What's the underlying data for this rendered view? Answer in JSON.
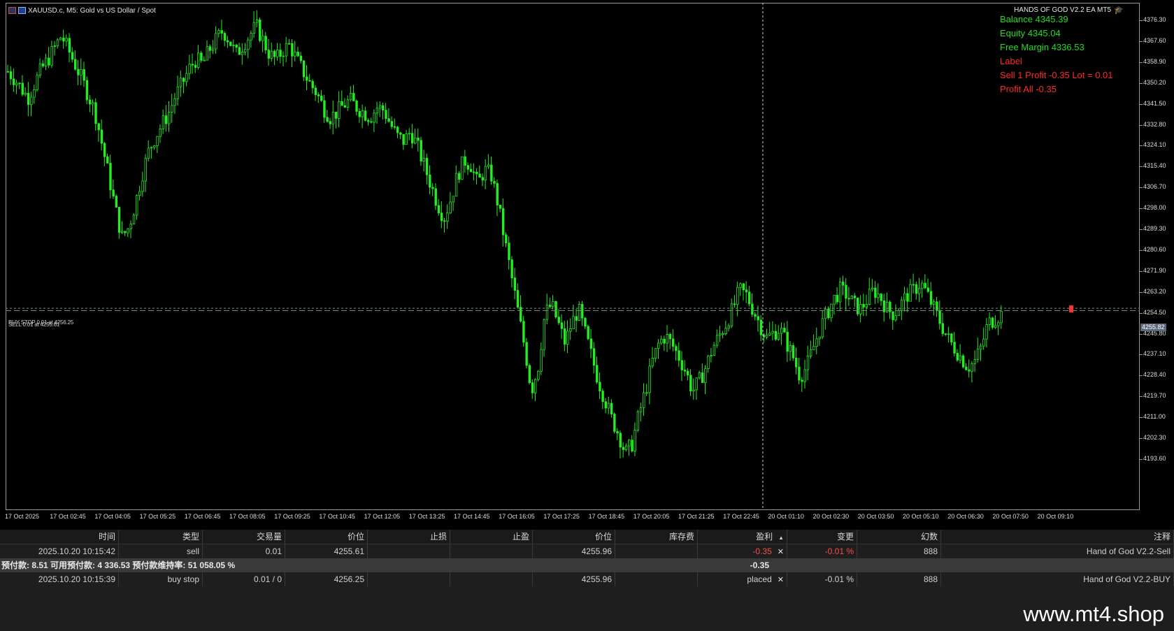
{
  "chart": {
    "symbol_line": "XAUUSD.c, M5:  Gold vs US Dollar / Spot",
    "ea_name": "HANDS OF GOD V2.2 EA MT5",
    "info": [
      {
        "text": "Balance 4345.39",
        "color": "#22dd22"
      },
      {
        "text": "Equity 4345.04",
        "color": "#22dd22"
      },
      {
        "text": "Free Margin 4336.53",
        "color": "#22dd22"
      },
      {
        "text": "Label",
        "color": "#ff2a2a"
      },
      {
        "text": "Sell 1   Profit -0.35  Lot = 0.01",
        "color": "#ff2a2a"
      },
      {
        "text": "Profit All -0.35",
        "color": "#ff2a2a"
      }
    ],
    "order_line_label": "BUY STOP 0.01 at 4256.25",
    "order_line_label2": "SELL 0.01 at 4255.61",
    "current_price": "4255.82",
    "price_ticks": [
      "4376.30",
      "4367.60",
      "4358.90",
      "4350.20",
      "4341.50",
      "4332.80",
      "4324.10",
      "4315.40",
      "4306.70",
      "4298.00",
      "4289.30",
      "4280.60",
      "4271.90",
      "4263.20",
      "4254.50",
      "4245.80",
      "4237.10",
      "4228.40",
      "4219.70",
      "4211.00",
      "4202.30",
      "4193.60"
    ],
    "time_ticks": [
      "17 Oct 2025",
      "17 Oct 02:45",
      "17 Oct 04:05",
      "17 Oct 05:25",
      "17 Oct 06:45",
      "17 Oct 08:05",
      "17 Oct 09:25",
      "17 Oct 10:45",
      "17 Oct 12:05",
      "17 Oct 13:25",
      "17 Oct 14:45",
      "17 Oct 16:05",
      "17 Oct 17:25",
      "17 Oct 18:45",
      "17 Oct 20:05",
      "17 Oct 21:25",
      "17 Oct 22:45",
      "20 Oct 01:10",
      "20 Oct 02:30",
      "20 Oct 03:50",
      "20 Oct 05:10",
      "20 Oct 06:30",
      "20 Oct 07:50",
      "20 Oct 09:10"
    ],
    "price_path": [
      4355,
      4352,
      4348,
      4344,
      4350,
      4356,
      4360,
      4365,
      4370,
      4364,
      4358,
      4352,
      4345,
      4338,
      4325,
      4312,
      4298,
      4286,
      4290,
      4300,
      4312,
      4322,
      4328,
      4333,
      4338,
      4345,
      4350,
      4356,
      4360,
      4358,
      4364,
      4368,
      4372,
      4368,
      4362,
      4366,
      4370,
      4374,
      4368,
      4362,
      4360,
      4364,
      4366,
      4360,
      4355,
      4350,
      4346,
      4340,
      4336,
      4338,
      4341,
      4343,
      4340,
      4338,
      4336,
      4340,
      4339,
      4333,
      4328,
      4326,
      4330,
      4324,
      4316,
      4308,
      4300,
      4294,
      4302,
      4312,
      4318,
      4316,
      4308,
      4314,
      4312,
      4300,
      4285,
      4270,
      4255,
      4240,
      4222,
      4232,
      4254,
      4258,
      4250,
      4242,
      4250,
      4256,
      4246,
      4236,
      4226,
      4218,
      4210,
      4204,
      4196,
      4200,
      4212,
      4222,
      4234,
      4242,
      4245,
      4241,
      4236,
      4230,
      4222,
      4226,
      4232,
      4240,
      4245,
      4250,
      4256,
      4264,
      4262,
      4256,
      4250,
      4244,
      4246,
      4248,
      4242,
      4236,
      4228,
      4232,
      4240,
      4248,
      4254,
      4260,
      4264,
      4262,
      4258,
      4256,
      4260,
      4264,
      4261,
      4256,
      4254,
      4258,
      4262,
      4264,
      4267,
      4262,
      4256,
      4250,
      4244,
      4240,
      4236,
      4232,
      4234,
      4240,
      4250,
      4252,
      4254
    ],
    "up_color": "#22ee22",
    "line_color": "#5f7a6a"
  },
  "table": {
    "headers": [
      "时间",
      "类型",
      "交易量",
      "价位",
      "止损",
      "止盈",
      "价位",
      "库存费",
      "盈利",
      "变更",
      "幻数",
      "注释"
    ],
    "sell_row": [
      "2025.10.20 10:15:42",
      "sell",
      "0.01",
      "4255.61",
      "",
      "",
      "4255.96",
      "",
      "-0.35",
      "-0.01 %",
      "888",
      "Hand of God V2.2-Sell"
    ],
    "summary_text": "预付款: 8.51  可用预付款: 4 336.53  预付款维持率: 51 058.05 %",
    "summary_profit": "-0.35",
    "buy_row": [
      "2025.10.20 10:15:39",
      "buy stop",
      "0.01 / 0",
      "4256.25",
      "",
      "",
      "4255.96",
      "",
      "placed",
      "-0.01 %",
      "888",
      "Hand of God V2.2-BUY"
    ],
    "sort_icon": "sort-up-icon",
    "close_icon": "close-icon"
  },
  "watermark": "www.mt4.shop"
}
